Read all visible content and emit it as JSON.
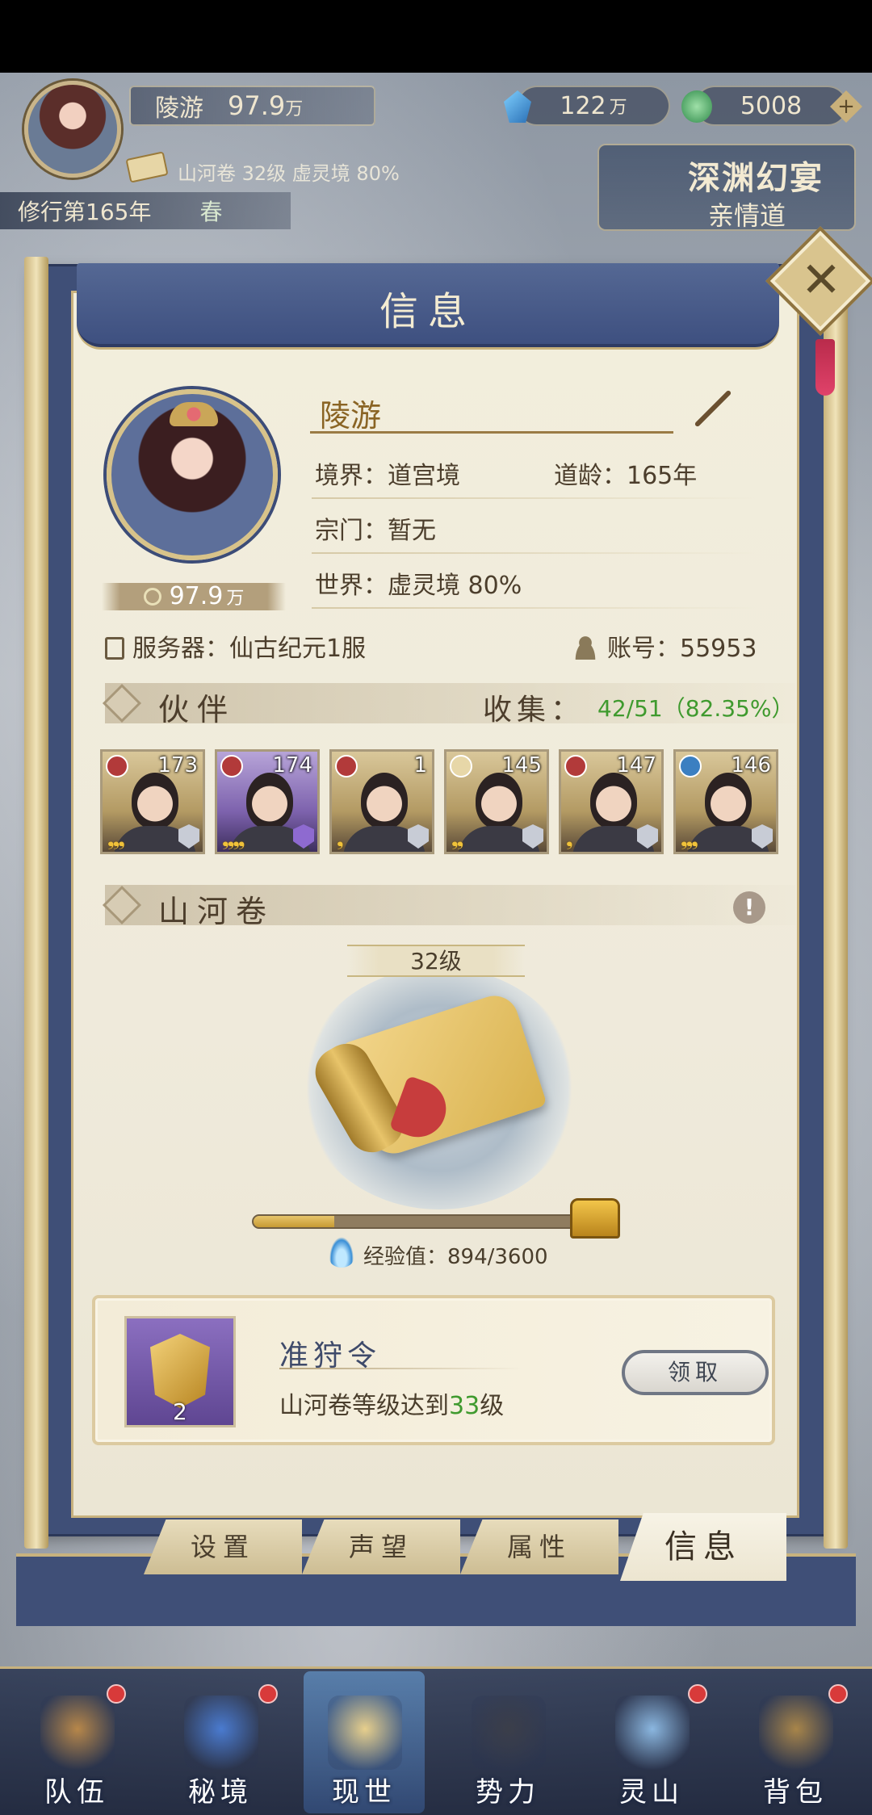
{
  "hud": {
    "player_name": "陵游",
    "power_value": "97.9",
    "power_unit": "万",
    "gem_value": "122",
    "gem_unit": "万",
    "jade_value": "5008",
    "plus_symbol": "+",
    "sub_info": "山河卷 32级 虚灵境 80%",
    "year_label": "修行第165年",
    "season": "春",
    "event_title": "深渊幻宴",
    "event_sub": "亲情道"
  },
  "panel": {
    "title": "信息",
    "close_symbol": "✕"
  },
  "profile": {
    "name": "陵游",
    "power_value": "97.9",
    "power_unit": "万",
    "realm": "境界：道宫境",
    "dao_age": "道龄：165年",
    "sect": "宗门：暂无",
    "world": "世界：虚灵境  80%",
    "server": "服务器：仙古纪元1服",
    "account": "账号：55953"
  },
  "partners_section": {
    "title": "伙伴",
    "collect_label": "收集：",
    "collect_value": "42/51（82.35%）",
    "items": [
      {
        "level": "173",
        "stars": "❟❟❟",
        "element": "fire",
        "purple": false
      },
      {
        "level": "174",
        "stars": "❟❟❟❟",
        "element": "fire",
        "purple": true
      },
      {
        "level": "1",
        "stars": "❟",
        "element": "fire",
        "purple": false
      },
      {
        "level": "145",
        "stars": "❟❟",
        "element": "light",
        "purple": false
      },
      {
        "level": "147",
        "stars": "❟",
        "element": "fire",
        "purple": false
      },
      {
        "level": "146",
        "stars": "❟❟❟",
        "element": "water",
        "purple": false
      }
    ]
  },
  "scroll_section": {
    "title": "山河卷",
    "info_symbol": "!",
    "level": "32级",
    "exp_label": "经验值：894/3600",
    "exp_current": 894,
    "exp_max": 3600
  },
  "reward": {
    "name": "准狩令",
    "count": "2",
    "desc_prefix": "山河卷等级达到",
    "desc_level": "33",
    "desc_suffix": "级",
    "claim_label": "领取"
  },
  "tabs": [
    {
      "label": "设置",
      "active": false
    },
    {
      "label": "声望",
      "active": false
    },
    {
      "label": "属性",
      "active": false
    },
    {
      "label": "信息",
      "active": true
    }
  ],
  "bottom_nav": [
    {
      "label": "队伍",
      "dot": true
    },
    {
      "label": "秘境",
      "dot": true
    },
    {
      "label": "现世",
      "dot": false,
      "active": true
    },
    {
      "label": "势力",
      "dot": false
    },
    {
      "label": "灵山",
      "dot": true
    },
    {
      "label": "背包",
      "dot": true
    }
  ],
  "colors": {
    "panel_blue": "#3f4f77",
    "paper": "#f2eedc",
    "gold": "#c8b27e",
    "green_highlight": "#3f9a2e"
  }
}
